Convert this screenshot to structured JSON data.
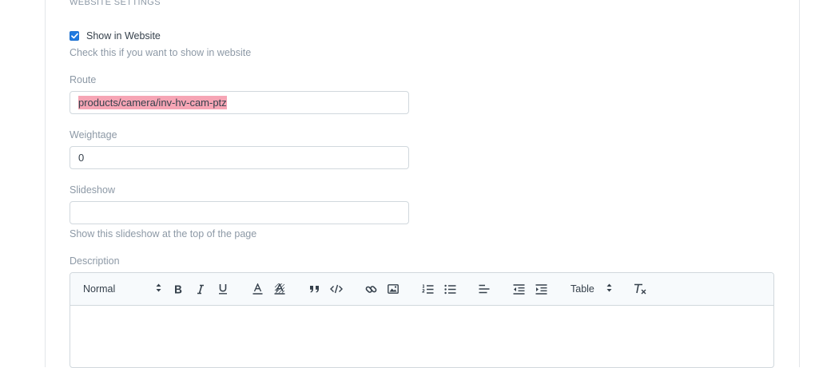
{
  "section": {
    "title": "WEBSITE SETTINGS"
  },
  "show_in_website": {
    "label": "Show in Website",
    "checked": true,
    "help": "Check this if you want to show in website"
  },
  "route": {
    "label": "Route",
    "value": "products/camera/inv-hv-cam-ptz"
  },
  "weightage": {
    "label": "Weightage",
    "value": "0"
  },
  "slideshow": {
    "label": "Slideshow",
    "value": "",
    "help": "Show this slideshow at the top of the page"
  },
  "description": {
    "label": "Description",
    "toolbar": {
      "format_select": "Normal",
      "table_select": "Table",
      "icons": [
        "bold-icon",
        "italic-icon",
        "underline-icon",
        "text-color-icon",
        "background-color-icon",
        "blockquote-icon",
        "code-block-icon",
        "link-icon",
        "image-icon",
        "ordered-list-icon",
        "bullet-list-icon",
        "align-icon",
        "outdent-icon",
        "indent-icon",
        "clear-formatting-icon"
      ]
    }
  },
  "colors": {
    "accent": "#1f7ae0",
    "highlight": "#f6a5b5",
    "muted_text": "#8d99a6",
    "border": "#d1d8dd"
  }
}
